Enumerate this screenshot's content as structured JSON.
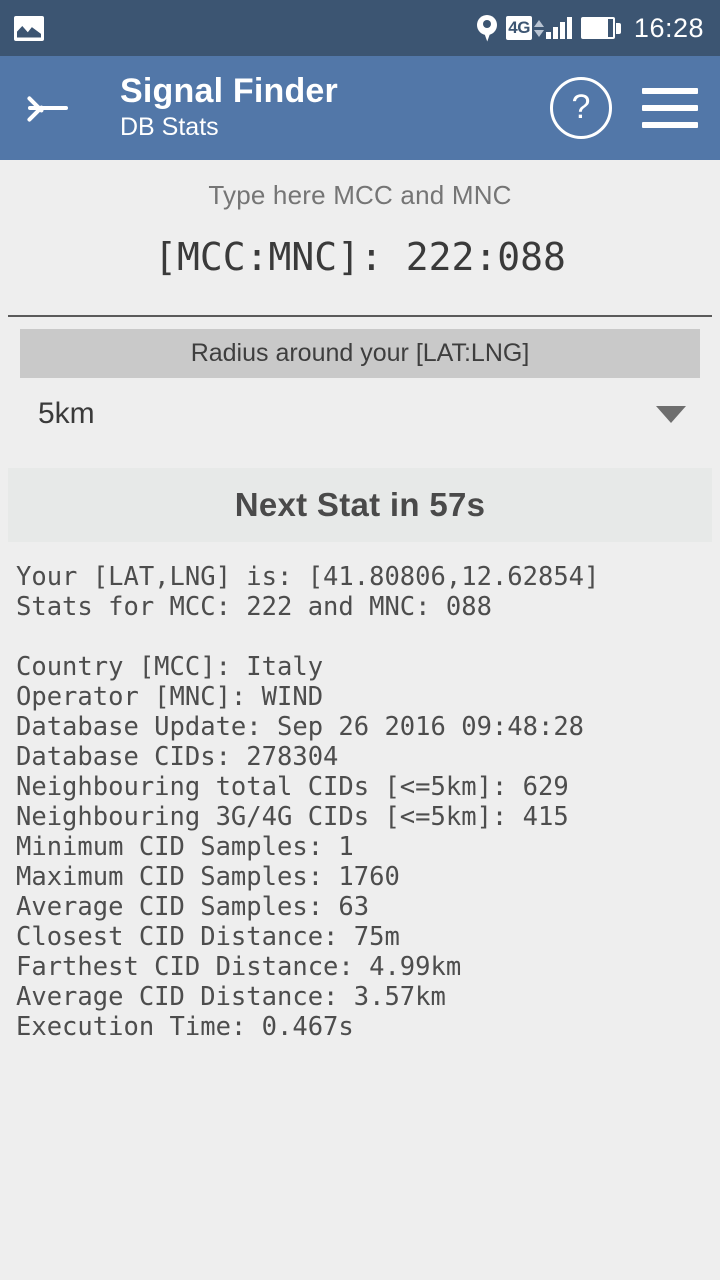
{
  "status_bar": {
    "notification_icon": "gallery-icon",
    "location_icon": "location-pin-icon",
    "network_type": "4G",
    "data_arrows_icon": "data-transfer-icon",
    "signal_icon": "signal-bars-icon",
    "battery_icon": "battery-icon",
    "time": "16:28"
  },
  "app_bar": {
    "back_icon": "back-arrow-icon",
    "title": "Signal Finder",
    "subtitle": "DB Stats",
    "help_label": "?",
    "help_icon": "help-circle-icon",
    "menu_icon": "hamburger-menu-icon"
  },
  "mcc_mnc": {
    "hint": "Type here MCC and MNC",
    "value": "[MCC:MNC]:  222:088"
  },
  "radius": {
    "header": "Radius around your [LAT:LNG]",
    "selected": "5km",
    "caret_icon": "chevron-down-icon"
  },
  "next_stat": {
    "label": "Next Stat in 57s"
  },
  "stats": {
    "lines": [
      "Your [LAT,LNG] is: [41.80806,12.62854]",
      "Stats for MCC: 222 and MNC: 088",
      "",
      "Country [MCC]: Italy",
      "Operator [MNC]: WIND",
      "Database Update: Sep 26 2016 09:48:28",
      "Database CIDs: 278304",
      "Neighbouring total CIDs [<=5km]: 629",
      "Neighbouring 3G/4G CIDs [<=5km]: 415",
      "Minimum CID Samples: 1",
      "Maximum CID Samples: 1760",
      "Average CID Samples: 63",
      "Closest CID Distance: 75m",
      "Farthest CID Distance: 4.99km",
      "Average CID Distance: 3.57km",
      "Execution Time: 0.467s"
    ],
    "text": "Your [LAT,LNG] is: [41.80806,12.62854]\nStats for MCC: 222 and MNC: 088\n\nCountry [MCC]: Italy\nOperator [MNC]: WIND\nDatabase Update: Sep 26 2016 09:48:28\nDatabase CIDs: 278304\nNeighbouring total CIDs [<=5km]: 629\nNeighbouring 3G/4G CIDs [<=5km]: 415\nMinimum CID Samples: 1\nMaximum CID Samples: 1760\nAverage CID Samples: 63\nClosest CID Distance: 75m\nFarthest CID Distance: 4.99km\nAverage CID Distance: 3.57km\nExecution Time: 0.467s"
  },
  "colors": {
    "status_bar_bg": "#3c5572",
    "app_bar_bg": "#5277a8",
    "page_bg": "#eeeeee",
    "header_band_bg": "#c9c9c9",
    "next_stat_bg": "#e7e9e8",
    "body_text": "#4d4d4d"
  }
}
